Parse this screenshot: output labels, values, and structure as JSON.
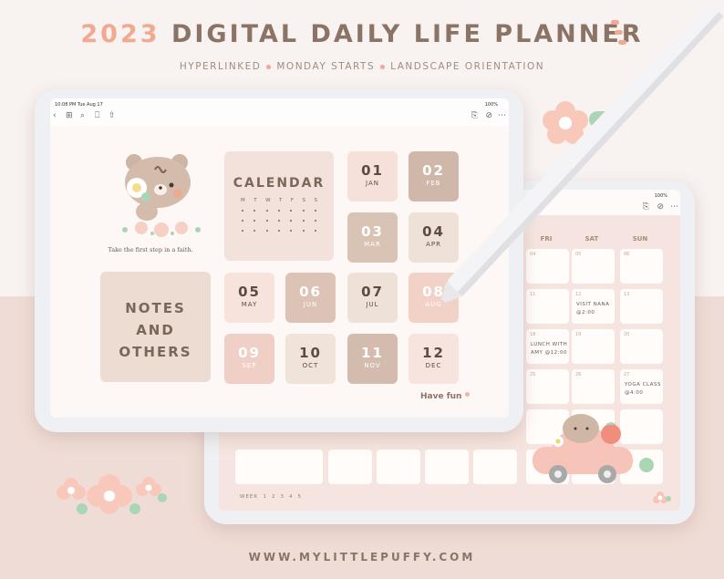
{
  "header": {
    "year": "2023",
    "title": "DIGITAL DAILY LIFE PLANNER",
    "subtitle": [
      "HYPERLINKED",
      "MONDAY STARTS",
      "LANDSCAPE ORIENTATION"
    ]
  },
  "front_ipad": {
    "status_time": "10:08 PM  Tue Aug 17",
    "status_battery": "100%",
    "toolbar_left": [
      "back-icon",
      "grid-icon",
      "search-icon",
      "bookmark-icon",
      "share-icon"
    ],
    "toolbar_right": [
      "add-page-icon",
      "pencil-icon",
      "more-icon"
    ],
    "quote": "Take the first step in a faith.",
    "calendar": {
      "label": "CALENDAR",
      "weekdays": [
        "M",
        "T",
        "W",
        "T",
        "F",
        "S",
        "S"
      ]
    },
    "notes_label": [
      "NOTES",
      "AND",
      "OTHERS"
    ],
    "months": [
      {
        "num": "01",
        "name": "JAN",
        "color": "#f5e0da",
        "text": "dark"
      },
      {
        "num": "02",
        "name": "FEB",
        "color": "#cfb8a9",
        "text": "light"
      },
      {
        "num": "03",
        "name": "MAR",
        "color": "#d9c3b5",
        "text": "light"
      },
      {
        "num": "04",
        "name": "APR",
        "color": "#eee2d8",
        "text": "dark"
      },
      {
        "num": "05",
        "name": "MAY",
        "color": "#f5e3dc",
        "text": "dark"
      },
      {
        "num": "06",
        "name": "JUN",
        "color": "#dcc3b5",
        "text": "light"
      },
      {
        "num": "07",
        "name": "JUL",
        "color": "#eee2d8",
        "text": "dark"
      },
      {
        "num": "08",
        "name": "AUG",
        "color": "#f2d2c7",
        "text": "light"
      },
      {
        "num": "09",
        "name": "SEP",
        "color": "#f0d0c6",
        "text": "light"
      },
      {
        "num": "10",
        "name": "OCT",
        "color": "#efe3da",
        "text": "dark"
      },
      {
        "num": "11",
        "name": "NOV",
        "color": "#d3bcad",
        "text": "light"
      },
      {
        "num": "12",
        "name": "DEC",
        "color": "#f7e4de",
        "text": "dark"
      }
    ],
    "have_fun": "Have fun"
  },
  "back_ipad": {
    "status_battery": "100%",
    "days": [
      "FRI",
      "SAT",
      "SUN"
    ],
    "rows": [
      [
        {
          "d": "04"
        },
        {
          "d": "05"
        },
        {
          "d": "06"
        }
      ],
      [
        {
          "d": "11"
        },
        {
          "d": "12",
          "e": [
            "VISIT NANA",
            "@2:00"
          ]
        },
        {
          "d": "13"
        }
      ],
      [
        {
          "d": "18",
          "e": [
            "LUNCH WITH",
            "AMY @12:00"
          ]
        },
        {
          "d": "19"
        },
        {
          "d": "20"
        }
      ],
      [
        {
          "d": "25"
        },
        {
          "d": "26"
        },
        {
          "d": "27",
          "e": [
            "YOGA CLASS",
            "@4:00"
          ]
        }
      ]
    ],
    "week_label": "WEEK",
    "weeks": [
      "1",
      "2",
      "3",
      "4",
      "5"
    ]
  },
  "footer": {
    "url": "WWW.MYLITTLEPUFFY.COM"
  },
  "colors": {
    "accent": "#f2a991",
    "brown": "#8b7466",
    "pink_band": "#f0dcd6",
    "green": "#a9d6b4"
  }
}
